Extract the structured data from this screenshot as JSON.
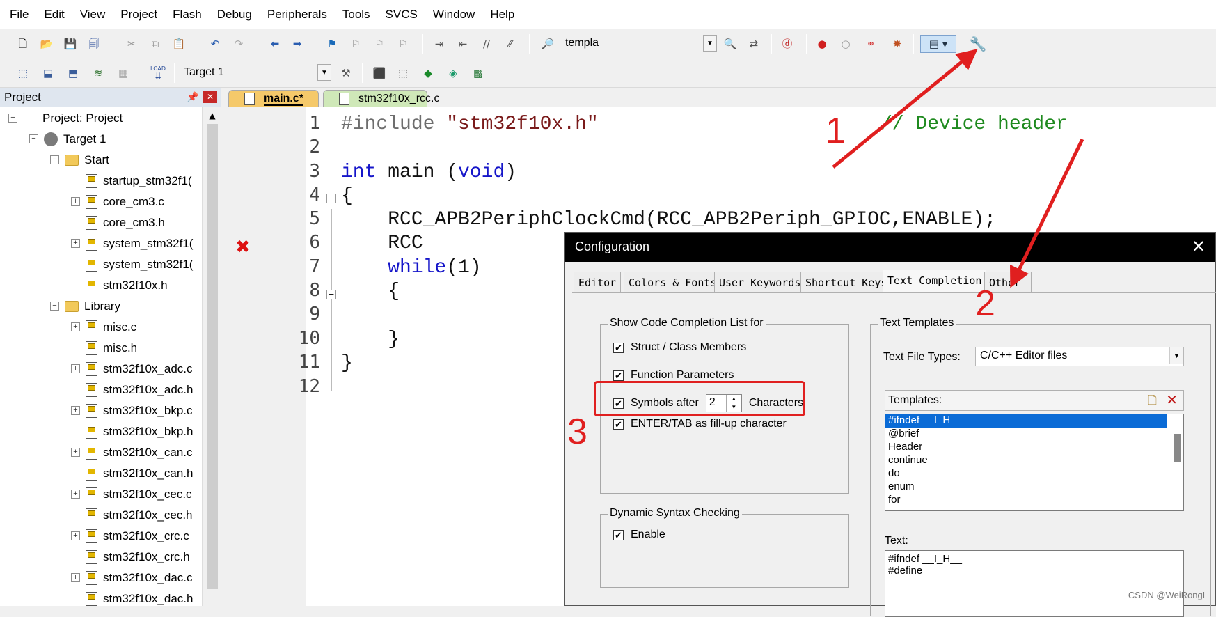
{
  "menu": [
    "File",
    "Edit",
    "View",
    "Project",
    "Flash",
    "Debug",
    "Peripherals",
    "Tools",
    "SVCS",
    "Window",
    "Help"
  ],
  "toolbar1": {
    "target_combo": "templa"
  },
  "toolbar2": {
    "target_select": "Target 1",
    "load_label": "LOAD"
  },
  "project_panel": {
    "title": "Project",
    "tree": [
      {
        "label": "Project: Project",
        "type": "project",
        "indent": 0,
        "expander": "⊟"
      },
      {
        "label": "Target 1",
        "type": "target",
        "indent": 1,
        "expander": "⊟"
      },
      {
        "label": "Start",
        "type": "folder",
        "indent": 2,
        "expander": "⊟"
      },
      {
        "label": "startup_stm32f1(",
        "type": "file",
        "indent": 3,
        "expander": ""
      },
      {
        "label": "core_cm3.c",
        "type": "file",
        "indent": 3,
        "expander": "⊞"
      },
      {
        "label": "core_cm3.h",
        "type": "file",
        "indent": 3,
        "expander": ""
      },
      {
        "label": "system_stm32f1(",
        "type": "file",
        "indent": 3,
        "expander": "⊞"
      },
      {
        "label": "system_stm32f1(",
        "type": "file",
        "indent": 3,
        "expander": ""
      },
      {
        "label": "stm32f10x.h",
        "type": "file",
        "indent": 3,
        "expander": ""
      },
      {
        "label": "Library",
        "type": "folder",
        "indent": 2,
        "expander": "⊟"
      },
      {
        "label": "misc.c",
        "type": "file",
        "indent": 3,
        "expander": "⊞"
      },
      {
        "label": "misc.h",
        "type": "file",
        "indent": 3,
        "expander": ""
      },
      {
        "label": "stm32f10x_adc.c",
        "type": "file",
        "indent": 3,
        "expander": "⊞"
      },
      {
        "label": "stm32f10x_adc.h",
        "type": "file",
        "indent": 3,
        "expander": ""
      },
      {
        "label": "stm32f10x_bkp.c",
        "type": "file",
        "indent": 3,
        "expander": "⊞"
      },
      {
        "label": "stm32f10x_bkp.h",
        "type": "file",
        "indent": 3,
        "expander": ""
      },
      {
        "label": "stm32f10x_can.c",
        "type": "file",
        "indent": 3,
        "expander": "⊞"
      },
      {
        "label": "stm32f10x_can.h",
        "type": "file",
        "indent": 3,
        "expander": ""
      },
      {
        "label": "stm32f10x_cec.c",
        "type": "file",
        "indent": 3,
        "expander": "⊞"
      },
      {
        "label": "stm32f10x_cec.h",
        "type": "file",
        "indent": 3,
        "expander": ""
      },
      {
        "label": "stm32f10x_crc.c",
        "type": "file",
        "indent": 3,
        "expander": "⊞"
      },
      {
        "label": "stm32f10x_crc.h",
        "type": "file",
        "indent": 3,
        "expander": ""
      },
      {
        "label": "stm32f10x_dac.c",
        "type": "file",
        "indent": 3,
        "expander": "⊞"
      },
      {
        "label": "stm32f10x_dac.h",
        "type": "file",
        "indent": 3,
        "expander": ""
      }
    ]
  },
  "editor": {
    "tabs": [
      {
        "label": "main.c*",
        "active": true
      },
      {
        "label": "stm32f10x_rcc.c",
        "active": false
      }
    ],
    "line_numbers": [
      "1",
      "2",
      "3",
      "4",
      "5",
      "6",
      "7",
      "8",
      "9",
      "10",
      "11",
      "12"
    ],
    "code": {
      "l1_directive": "#include",
      "l1_string": "\"stm32f10x.h\"",
      "l1_comment": "// Device header",
      "l3_int": "int",
      "l3_main": " main (",
      "l3_void": "void",
      "l3_close": ")",
      "l4": "{",
      "l5": "    RCC_APB2PeriphClockCmd(RCC_APB2Periph_GPIOC,ENABLE);",
      "l6": "    RCC",
      "l7_while": "    while",
      "l7_rest": "(1)",
      "l8": "    {",
      "l10": "    }",
      "l11": "}"
    }
  },
  "dialog": {
    "title": "Configuration",
    "tabs": [
      "Editor",
      "Colors & Fonts",
      "User Keywords",
      "Shortcut Keys",
      "Text Completion",
      "Other"
    ],
    "selected_tab": "Text Completion",
    "completion_group": {
      "title": "Show Code Completion List for",
      "struct_members": "Struct / Class Members",
      "function_params": "Function Parameters",
      "symbols_after": "Symbols after",
      "symbols_count": "2",
      "characters": "Characters",
      "enter_tab": "ENTER/TAB as fill-up character"
    },
    "syntax_group": {
      "title": "Dynamic Syntax Checking",
      "enable": "Enable"
    },
    "templates_group": {
      "title": "Text Templates",
      "file_types_label": "Text File Types:",
      "file_types_value": "C/C++ Editor files",
      "templates_label": "Templates:",
      "templates": [
        "#ifndef __I_H__",
        "@brief",
        "Header",
        "continue",
        "do",
        "enum",
        "for"
      ],
      "text_label": "Text:",
      "text_lines": [
        "#ifndef __I_H__",
        "#define"
      ]
    }
  },
  "annotations": {
    "n1": "1",
    "n2": "2",
    "n3": "3",
    "color": "#e01f1f"
  },
  "watermark": "CSDN @WeiRongL"
}
